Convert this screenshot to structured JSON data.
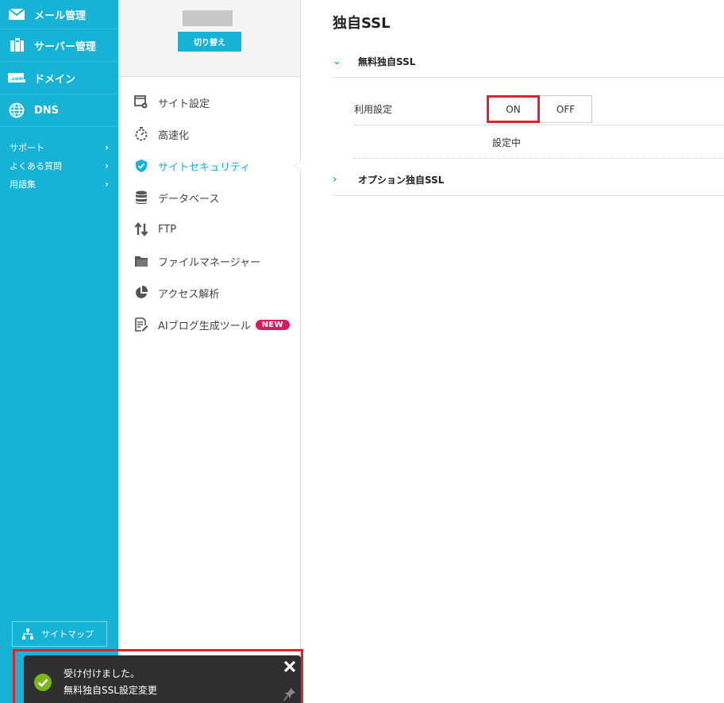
{
  "sidebar": {
    "nav": [
      {
        "label": "メール管理",
        "icon": "mail-icon"
      },
      {
        "label": "サーバー管理",
        "icon": "server-icon"
      },
      {
        "label": "ドメイン",
        "icon": "domain-icon"
      },
      {
        "label": "DNS",
        "icon": "globe-icon"
      }
    ],
    "links": [
      {
        "label": "サポート"
      },
      {
        "label": "よくある質問"
      },
      {
        "label": "用語集"
      }
    ],
    "sitemap_label": "サイトマップ"
  },
  "middle": {
    "switch_label": "切り替え",
    "menu": [
      {
        "label": "サイト設定",
        "icon": "site-settings-icon"
      },
      {
        "label": "高速化",
        "icon": "stopwatch-icon"
      },
      {
        "label": "サイトセキュリティ",
        "icon": "shield-icon",
        "active": true
      },
      {
        "label": "データベース",
        "icon": "database-icon"
      },
      {
        "label": "FTP",
        "icon": "transfer-icon"
      },
      {
        "label": "ファイルマネージャー",
        "icon": "folder-icon"
      },
      {
        "label": "アクセス解析",
        "icon": "pie-chart-icon"
      },
      {
        "label": "AIブログ生成ツール",
        "icon": "document-edit-icon",
        "badge": "NEW"
      }
    ]
  },
  "content": {
    "title": "独自SSL",
    "free_ssl": {
      "heading": "無料独自SSL",
      "setting_label": "利用設定",
      "on_label": "ON",
      "off_label": "OFF",
      "selected": "ON",
      "status": "設定中"
    },
    "option_ssl": {
      "heading": "オプション独自SSL"
    }
  },
  "toast": {
    "line1": "受け付けました。",
    "line2": "無料独自SSL設定変更"
  },
  "colors": {
    "accent": "#16b3d6",
    "highlight": "#e4202e",
    "badge": "#d81b60",
    "toast_bg": "#2f2f2f",
    "success": "#7cb518"
  }
}
